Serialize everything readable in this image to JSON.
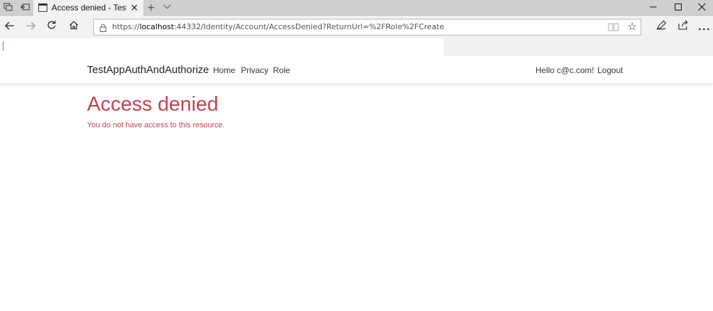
{
  "browser": {
    "tab_title": "Access denied - TestAppAuthAndAuthorize",
    "url_prefix": "https://",
    "url_host": "localhost",
    "url_rest": ":44332/Identity/Account/AccessDenied?ReturnUrl=%2FRole%2FCreate"
  },
  "site": {
    "brand": "TestAppAuthAndAuthorize",
    "nav": [
      {
        "label": "Home"
      },
      {
        "label": "Privacy"
      },
      {
        "label": "Role"
      }
    ],
    "greeting": "Hello c@c.com!",
    "logout_label": "Logout"
  },
  "main": {
    "title": "Access denied",
    "message": "You do not have access to this resource."
  },
  "colors": {
    "danger": "#c0444d",
    "chrome": "#cfcfcf"
  }
}
